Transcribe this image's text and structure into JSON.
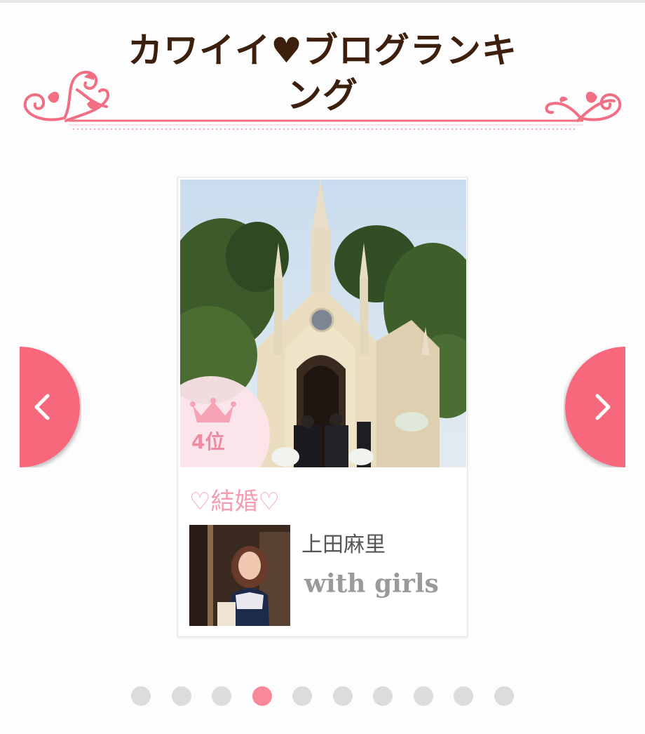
{
  "header": {
    "title": "カワイイ♥ブログランキング"
  },
  "card": {
    "rank_label": "4位",
    "blog_title": "♡結婚♡",
    "author_name": "上田麻里",
    "category": "with girls"
  },
  "carousel": {
    "prev_icon": "chevron-left-icon",
    "next_icon": "chevron-right-icon",
    "page_count": 10,
    "active_index": 3
  },
  "colors": {
    "title": "#3d1f0e",
    "accent_pink": "#f8677b",
    "ornament_pink": "#f26e83",
    "dot_inactive": "#dcdcdc",
    "dot_active": "#f8899a",
    "blog_title": "#f59db0"
  }
}
